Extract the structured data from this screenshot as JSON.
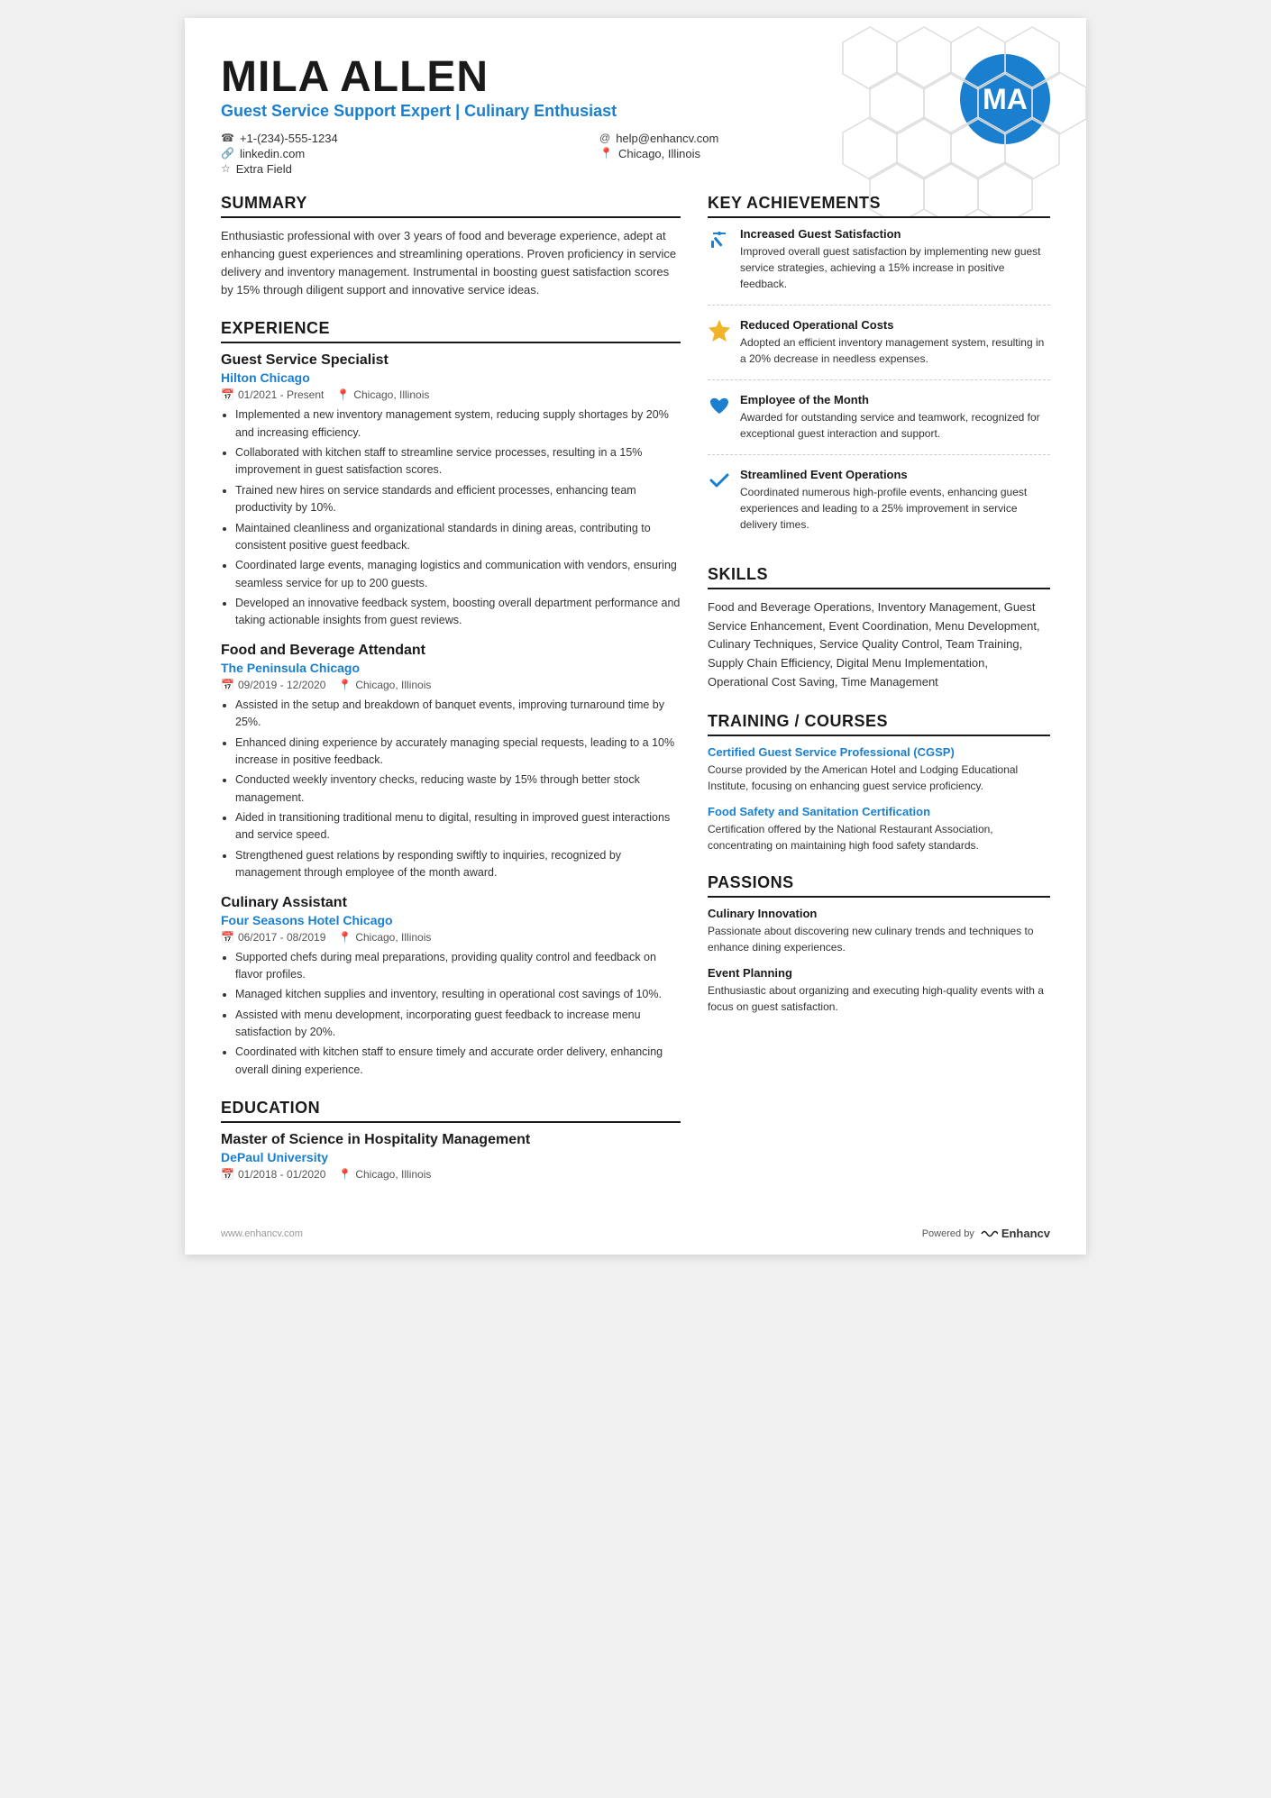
{
  "header": {
    "name": "MILA ALLEN",
    "title": "Guest Service Support Expert | Culinary Enthusiast",
    "phone": "+1-(234)-555-1234",
    "linkedin": "linkedin.com",
    "extra_field": "Extra Field",
    "email": "help@enhancv.com",
    "location": "Chicago, Illinois",
    "avatar_initials": "MA"
  },
  "summary": {
    "title": "SUMMARY",
    "text": "Enthusiastic professional with over 3 years of food and beverage experience, adept at enhancing guest experiences and streamlining operations. Proven proficiency in service delivery and inventory management. Instrumental in boosting guest satisfaction scores by 15% through diligent support and innovative service ideas."
  },
  "experience": {
    "title": "EXPERIENCE",
    "jobs": [
      {
        "job_title": "Guest Service Specialist",
        "company": "Hilton Chicago",
        "date_range": "01/2021 - Present",
        "location": "Chicago, Illinois",
        "bullets": [
          "Implemented a new inventory management system, reducing supply shortages by 20% and increasing efficiency.",
          "Collaborated with kitchen staff to streamline service processes, resulting in a 15% improvement in guest satisfaction scores.",
          "Trained new hires on service standards and efficient processes, enhancing team productivity by 10%.",
          "Maintained cleanliness and organizational standards in dining areas, contributing to consistent positive guest feedback.",
          "Coordinated large events, managing logistics and communication with vendors, ensuring seamless service for up to 200 guests.",
          "Developed an innovative feedback system, boosting overall department performance and taking actionable insights from guest reviews."
        ]
      },
      {
        "job_title": "Food and Beverage Attendant",
        "company": "The Peninsula Chicago",
        "date_range": "09/2019 - 12/2020",
        "location": "Chicago, Illinois",
        "bullets": [
          "Assisted in the setup and breakdown of banquet events, improving turnaround time by 25%.",
          "Enhanced dining experience by accurately managing special requests, leading to a 10% increase in positive feedback.",
          "Conducted weekly inventory checks, reducing waste by 15% through better stock management.",
          "Aided in transitioning traditional menu to digital, resulting in improved guest interactions and service speed.",
          "Strengthened guest relations by responding swiftly to inquiries, recognized by management through employee of the month award."
        ]
      },
      {
        "job_title": "Culinary Assistant",
        "company": "Four Seasons Hotel Chicago",
        "date_range": "06/2017 - 08/2019",
        "location": "Chicago, Illinois",
        "bullets": [
          "Supported chefs during meal preparations, providing quality control and feedback on flavor profiles.",
          "Managed kitchen supplies and inventory, resulting in operational cost savings of 10%.",
          "Assisted with menu development, incorporating guest feedback to increase menu satisfaction by 20%.",
          "Coordinated with kitchen staff to ensure timely and accurate order delivery, enhancing overall dining experience."
        ]
      }
    ]
  },
  "education": {
    "title": "EDUCATION",
    "degree": "Master of Science in Hospitality Management",
    "school": "DePaul University",
    "date_range": "01/2018 - 01/2020",
    "location": "Chicago, Illinois"
  },
  "key_achievements": {
    "title": "KEY ACHIEVEMENTS",
    "items": [
      {
        "title": "Increased Guest Satisfaction",
        "text": "Improved overall guest satisfaction by implementing new guest service strategies, achieving a 15% increase in positive feedback.",
        "icon_type": "pencil"
      },
      {
        "title": "Reduced Operational Costs",
        "text": "Adopted an efficient inventory management system, resulting in a 20% decrease in needless expenses.",
        "icon_type": "star"
      },
      {
        "title": "Employee of the Month",
        "text": "Awarded for outstanding service and teamwork, recognized for exceptional guest interaction and support.",
        "icon_type": "heart"
      },
      {
        "title": "Streamlined Event Operations",
        "text": "Coordinated numerous high-profile events, enhancing guest experiences and leading to a 25% improvement in service delivery times.",
        "icon_type": "check"
      }
    ]
  },
  "skills": {
    "title": "SKILLS",
    "text": "Food and Beverage Operations, Inventory Management, Guest Service Enhancement, Event Coordination, Menu Development, Culinary Techniques, Service Quality Control, Team Training, Supply Chain Efficiency, Digital Menu Implementation, Operational Cost Saving, Time Management"
  },
  "training": {
    "title": "TRAINING / COURSES",
    "items": [
      {
        "title": "Certified Guest Service Professional (CGSP)",
        "text": "Course provided by the American Hotel and Lodging Educational Institute, focusing on enhancing guest service proficiency."
      },
      {
        "title": "Food Safety and Sanitation Certification",
        "text": "Certification offered by the National Restaurant Association, concentrating on maintaining high food safety standards."
      }
    ]
  },
  "passions": {
    "title": "PASSIONS",
    "items": [
      {
        "title": "Culinary Innovation",
        "text": "Passionate about discovering new culinary trends and techniques to enhance dining experiences."
      },
      {
        "title": "Event Planning",
        "text": "Enthusiastic about organizing and executing high-quality events with a focus on guest satisfaction."
      }
    ]
  },
  "footer": {
    "website": "www.enhancv.com",
    "powered_by": "Powered by",
    "brand": "Enhancv"
  }
}
